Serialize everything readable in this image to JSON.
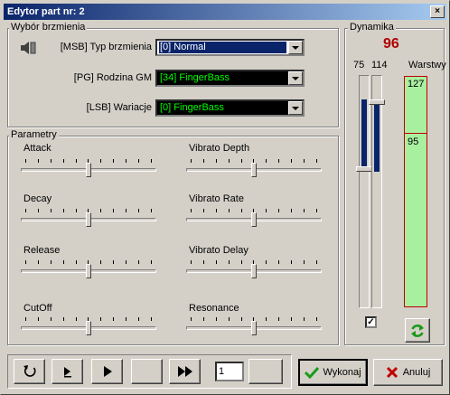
{
  "window": {
    "title": "Edytor part nr: 2"
  },
  "voice_group": {
    "label": "Wybór brzmienia",
    "msb_label": "[MSB] Typ brzmienia",
    "msb_value": "[0] Normal",
    "pg_label": "[PG] Rodzina GM",
    "pg_value": "[34] FingerBass",
    "lsb_label": "[LSB] Wariacje",
    "lsb_value": "[0] FingerBass",
    "colors": {
      "selected_bg": "#0a246a",
      "dark_bg": "#000000",
      "green_text": "#00ff00"
    }
  },
  "params": {
    "label": "Parametry",
    "attack": "Attack",
    "decay": "Decay",
    "release": "Release",
    "cutoff": "CutOff",
    "vib_depth": "Vibrato Depth",
    "vib_rate": "Vibrato Rate",
    "vib_delay": "Vibrato Delay",
    "resonance": "Resonance",
    "slider_level": 0.5
  },
  "dynamics": {
    "label": "Dynamika",
    "value": "96",
    "low": "75",
    "high": "114",
    "layers_label": "Warstwy",
    "layer_top": "127",
    "layer_split": "95",
    "value_color": "#b00000"
  },
  "footer": {
    "counter": "1",
    "ok": "Wykonaj",
    "cancel": "Anuluj"
  }
}
